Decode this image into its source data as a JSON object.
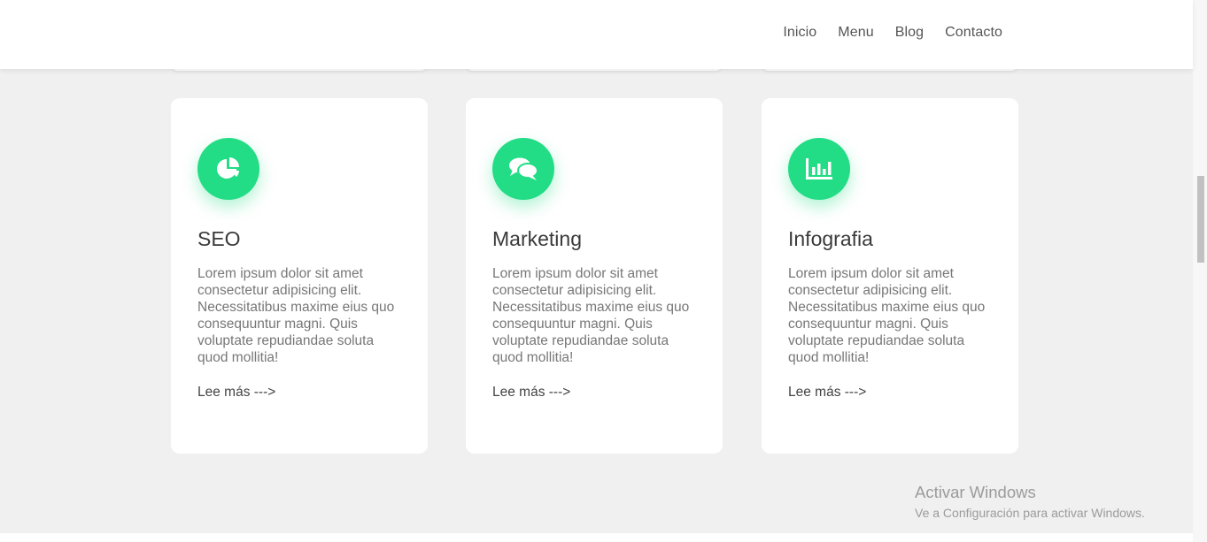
{
  "nav": {
    "items": [
      {
        "label": "Inicio"
      },
      {
        "label": "Menu"
      },
      {
        "label": "Blog"
      },
      {
        "label": "Contacto"
      }
    ]
  },
  "cards": [
    {
      "icon": "pie-chart-icon",
      "title": "SEO",
      "text": "Lorem ipsum dolor sit amet consectetur adipisicing elit. Necessitatibus maxime eius quo consequuntur magni. Quis voluptate repudiandae soluta quod mollitia!",
      "link": "Lee más --->"
    },
    {
      "icon": "comments-icon",
      "title": "Marketing",
      "text": "Lorem ipsum dolor sit amet consectetur adipisicing elit. Necessitatibus maxime eius quo consequuntur magni. Quis voluptate repudiandae soluta quod mollitia!",
      "link": "Lee más --->"
    },
    {
      "icon": "bar-chart-icon",
      "title": "Infografia",
      "text": "Lorem ipsum dolor sit amet consectetur adipisicing elit. Necessitatibus maxime eius quo consequuntur magni. Quis voluptate repudiandae soluta quod mollitia!",
      "link": "Lee más --->"
    }
  ],
  "watermark": {
    "title": "Activar Windows",
    "subtitle": "Ve a Configuración para activar Windows."
  },
  "colors": {
    "accent": "#22dd85",
    "background": "#f0f0f0",
    "card": "#ffffff"
  }
}
